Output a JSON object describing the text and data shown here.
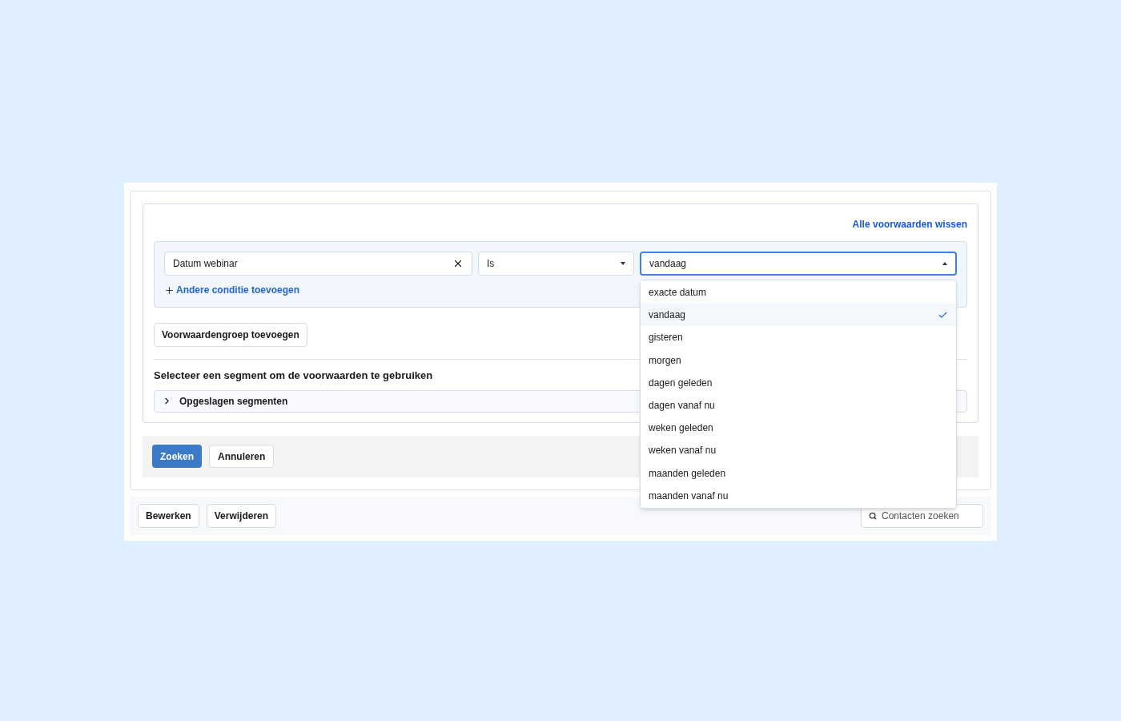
{
  "clear_all_link": "Alle voorwaarden wissen",
  "condition": {
    "field": {
      "value": "Datum webinar"
    },
    "operator": {
      "value": "Is"
    },
    "value_select": {
      "value": "vandaag",
      "expanded": true,
      "options": [
        {
          "label": "exacte datum",
          "selected": false
        },
        {
          "label": "vandaag",
          "selected": true
        },
        {
          "label": "gisteren",
          "selected": false
        },
        {
          "label": "morgen",
          "selected": false
        },
        {
          "label": "dagen geleden",
          "selected": false
        },
        {
          "label": "dagen vanaf nu",
          "selected": false
        },
        {
          "label": "weken geleden",
          "selected": false
        },
        {
          "label": "weken vanaf nu",
          "selected": false
        },
        {
          "label": "maanden geleden",
          "selected": false
        },
        {
          "label": "maanden vanaf nu",
          "selected": false
        }
      ]
    }
  },
  "add_condition_link": "Andere conditie toevoegen",
  "add_group_button": "Voorwaardengroep toevoegen",
  "segment_heading": "Selecteer een segment om de voorwaarden te gebruiken",
  "saved_segments": {
    "label": "Opgeslagen segmenten",
    "expanded": false
  },
  "form_buttons": [
    {
      "label": "Zoeken",
      "kind": "primary"
    },
    {
      "label": "Annuleren",
      "kind": "secondary"
    }
  ],
  "footer_buttons": [
    "Bewerken",
    "Verwijderen"
  ],
  "contact_search": {
    "placeholder": "Contacten zoeken"
  }
}
